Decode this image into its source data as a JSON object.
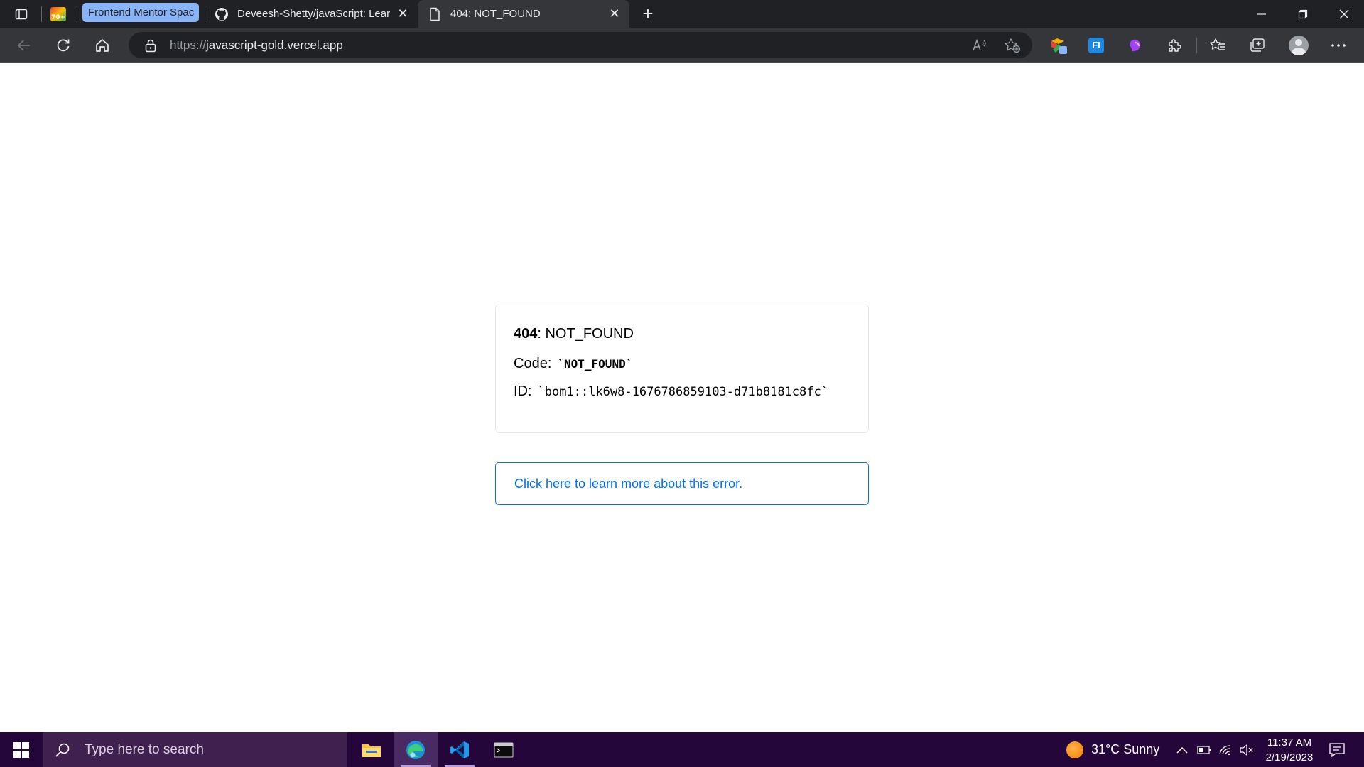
{
  "browser": {
    "tabs": [
      {
        "label": "Frontend Mentor Spac",
        "kind": "group"
      },
      {
        "label": "Deveesh-Shetty/javaScript: Learn",
        "favicon": "github-icon"
      },
      {
        "label": "404: NOT_FOUND",
        "favicon": "page-icon",
        "active": true
      }
    ],
    "pinned_badge": "70+",
    "url_scheme": "https://",
    "url_host": "javascript-gold.vercel.app"
  },
  "error": {
    "status_code": "404",
    "status_text": ": NOT_FOUND",
    "code_label": "Code:",
    "code_value": "`NOT_FOUND`",
    "id_label": "ID:",
    "id_value": "`bom1::lk6w8-1676786859103-d71b8181c8fc`",
    "link_text": "Click here to learn more about this error."
  },
  "taskbar": {
    "search_placeholder": "Type here to search",
    "weather": "31°C  Sunny",
    "time": "11:37 AM",
    "date": "2/19/2023"
  },
  "colors": {
    "link_blue": "#0070f3",
    "taskbar_bg": "#24063a",
    "browser_frame": "#202124",
    "tab_group": "#8ab4f8"
  }
}
